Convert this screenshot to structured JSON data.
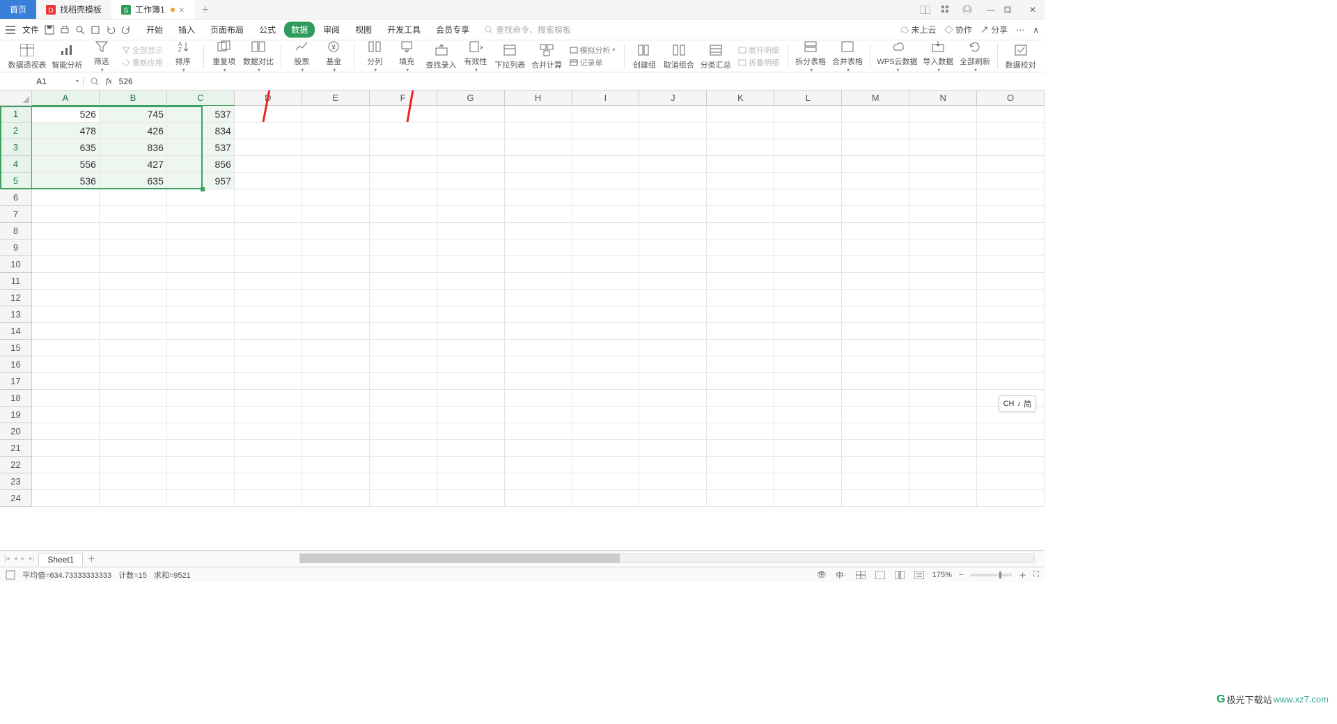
{
  "titlebar": {
    "tabs": [
      {
        "label": "首页",
        "type": "home"
      },
      {
        "label": "找稻壳模板",
        "type": "dk"
      },
      {
        "label": "工作簿1",
        "type": "wps",
        "modified": true
      }
    ]
  },
  "menubar": {
    "file": "文件",
    "items": [
      "开始",
      "插入",
      "页面布局",
      "公式",
      "数据",
      "审阅",
      "视图",
      "开发工具",
      "会员专享"
    ],
    "active": "数据",
    "search_placeholder": "查找命令、搜索模板",
    "right": {
      "cloud": "未上云",
      "coop": "协作",
      "share": "分享"
    }
  },
  "ribbon": {
    "items": [
      "数据透视表",
      "智能分析",
      "筛选",
      "全部显示",
      "重新应用",
      "排序",
      "重复项",
      "数据对比",
      "股票",
      "基金",
      "分列",
      "填充",
      "查找录入",
      "有效性",
      "下拉列表",
      "合并计算",
      "模拟分析",
      "记录单",
      "创建组",
      "取消组合",
      "分类汇总",
      "展开明细",
      "折叠明细",
      "拆分表格",
      "合并表格",
      "WPS云数据",
      "导入数据",
      "全部刷新",
      "数据校对"
    ]
  },
  "formula": {
    "cell_ref": "A1",
    "value": "526"
  },
  "columns": [
    "A",
    "B",
    "C",
    "D",
    "E",
    "F",
    "G",
    "H",
    "I",
    "J",
    "K",
    "L",
    "M",
    "N",
    "O"
  ],
  "col_widths": {
    "default": 97
  },
  "rows": 24,
  "selection": {
    "r1": 1,
    "c1": 1,
    "r2": 5,
    "c2": 3
  },
  "chart_data": {
    "type": "table",
    "columns": [
      "A",
      "B",
      "C"
    ],
    "rows": [
      [
        526,
        745,
        537
      ],
      [
        478,
        426,
        834
      ],
      [
        635,
        836,
        537
      ],
      [
        556,
        427,
        856
      ],
      [
        536,
        635,
        957
      ]
    ]
  },
  "sheet": {
    "name": "Sheet1"
  },
  "status": {
    "avg_label": "平均值=",
    "avg": "634.73333333333",
    "count_label": "计数=",
    "count": "15",
    "sum_label": "求和=",
    "sum": "9521",
    "zoom": "175%"
  },
  "ime": {
    "lang": "CH",
    "mode": "简"
  },
  "watermark": {
    "brand": "极光下载站",
    "url": "www.xz7.com"
  }
}
